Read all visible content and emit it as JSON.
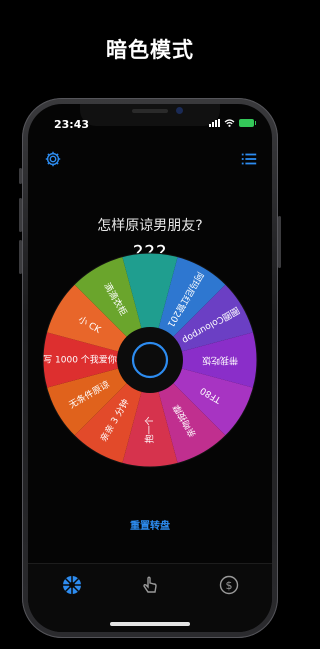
{
  "headline": "暗色模式",
  "status": {
    "time": "23:43"
  },
  "question": "怎样原谅男朋友?",
  "answer": "???",
  "reset_label": "重置转盘",
  "toolbar": {
    "settings_icon": "gear-icon",
    "list_icon": "list-icon"
  },
  "wheel": {
    "segments": [
      {
        "label": "阿玛尼红管201",
        "color": "#2e77d0"
      },
      {
        "label": "圈圈Colourpop",
        "color": "#6b3fc4"
      },
      {
        "label": "带我吃饭",
        "color": "#8a2ec9"
      },
      {
        "label": "TF80",
        "color": "#a734c2"
      },
      {
        "label": "亲吻按摩",
        "color": "#c02f8f"
      },
      {
        "label": "抱一个",
        "color": "#d6334d"
      },
      {
        "label": "亲亲 3 分钟",
        "color": "#e24a2a"
      },
      {
        "label": "无条件原谅",
        "color": "#e0621c"
      },
      {
        "label": "写 1000 个我爱你",
        "color": "#dd2f2f"
      },
      {
        "label": "小 CK",
        "color": "#e8662a"
      },
      {
        "label": "滴滴衣柜",
        "color": "#6aa52c"
      },
      {
        "label": "",
        "color": "#1f9e8f"
      }
    ]
  },
  "tabs": [
    {
      "name": "wheel",
      "icon": "wheel-icon",
      "active": true
    },
    {
      "name": "tap",
      "icon": "hand-tap-icon",
      "active": false
    },
    {
      "name": "purchase",
      "icon": "dollar-icon",
      "active": false
    }
  ],
  "colors": {
    "accent": "#2d8cf0",
    "background": "#000000"
  }
}
